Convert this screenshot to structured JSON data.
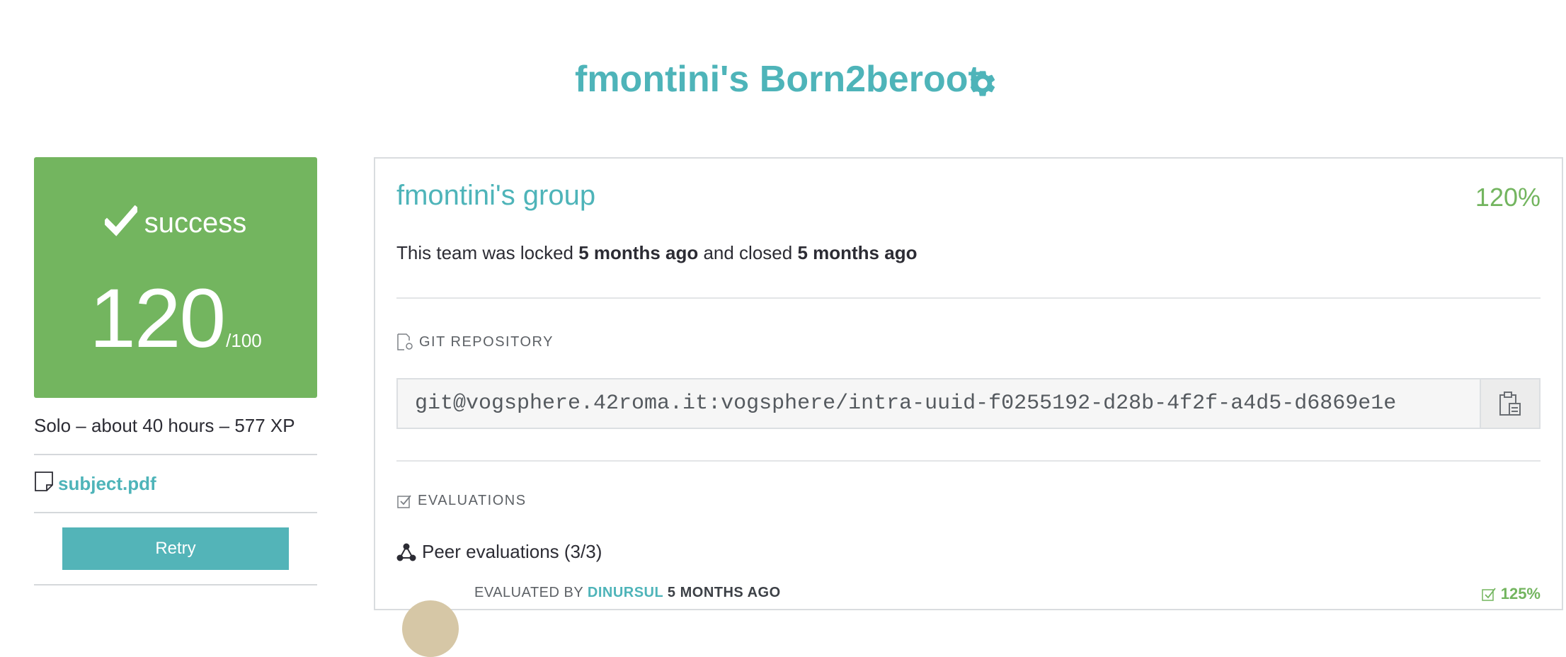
{
  "header": {
    "title": "fmontini's Born2beroot",
    "settings_icon": "gear-icon"
  },
  "project": {
    "status": "success",
    "score": "120",
    "score_max": "/100",
    "meta": "Solo – about 40 hours – 577 XP",
    "subject_file": "subject.pdf",
    "retry_label": "Retry",
    "colors": {
      "accent": "#4eb4b9",
      "success": "#73b55f"
    }
  },
  "group": {
    "title": "fmontini's group",
    "grade": "120%",
    "lock_prefix": "This team was locked ",
    "locked_when": "5 months ago",
    "lock_middle": " and closed ",
    "closed_when": "5 months ago",
    "repo_label": "GIT REPOSITORY",
    "repo_url": "git@vogsphere.42roma.it:vogsphere/intra-uuid-f0255192-d28b-4f2f-a4d5-d6869e1e",
    "evaluations_label": "EVALUATIONS",
    "peer_evaluations": "Peer evaluations (3/3)",
    "evaluation": {
      "evaluated_by": "EVALUATED BY ",
      "evaluator": "DINURSUL",
      "time": " 5 MONTHS AGO",
      "grade": "125%"
    }
  }
}
